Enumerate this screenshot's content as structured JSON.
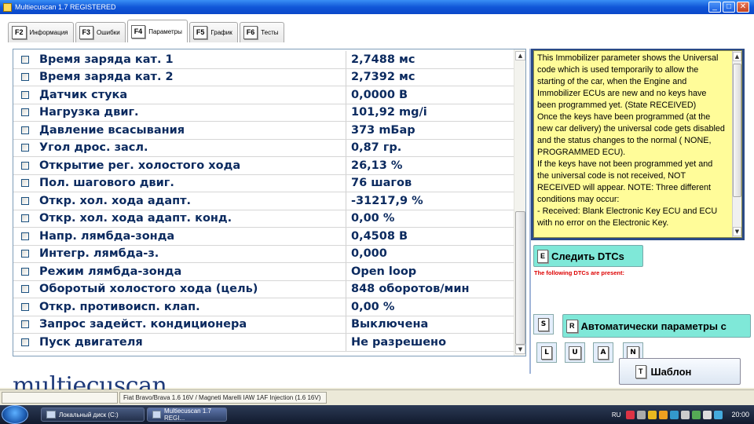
{
  "window": {
    "title": "Multiecuscan 1.7 REGISTERED"
  },
  "tabs": [
    {
      "key": "F2",
      "label": "Информация"
    },
    {
      "key": "F3",
      "label": "Ошибки"
    },
    {
      "key": "F4",
      "label": "Параметры",
      "active": true
    },
    {
      "key": "F5",
      "label": "График"
    },
    {
      "key": "F6",
      "label": "Тесты"
    }
  ],
  "parameters": [
    {
      "name": "Время заряда кат. 1",
      "value": "2,7488 мс"
    },
    {
      "name": "Время заряда кат. 2",
      "value": "2,7392 мс"
    },
    {
      "name": "Датчик стука",
      "value": "0,0000 В"
    },
    {
      "name": "Нагрузка двиг.",
      "value": "101,92 mg/i"
    },
    {
      "name": "Давление всасывания",
      "value": "373 mБар"
    },
    {
      "name": "Угол дрос. засл.",
      "value": "0,87 гр."
    },
    {
      "name": "Открытие рег. холостого хода",
      "value": "26,13 %"
    },
    {
      "name": "Пол. шагового двиг.",
      "value": "76 шагов"
    },
    {
      "name": "Откр. хол. хода адапт.",
      "value": "-31217,9 %"
    },
    {
      "name": "Откр. хол. хода адапт. конд.",
      "value": "0,00 %"
    },
    {
      "name": "Напр. лямбда-зонда",
      "value": "0,4508 В"
    },
    {
      "name": "Интегр. лямбда-з.",
      "value": "0,000"
    },
    {
      "name": "Режим лямбда-зонда",
      "value": "Open loop"
    },
    {
      "name": "Оборотый холостого хода (цель)",
      "value": "848 оборотов/мин"
    },
    {
      "name": "Откр. противоисп. клап.",
      "value": "0,00 %"
    },
    {
      "name": "Запрос задейст. кондиционера",
      "value": "Выключена"
    },
    {
      "name": "Пуск двигателя",
      "value": "Не разрешено"
    }
  ],
  "info_text": "This Immobilizer parameter shows the Universal code which is used temporarily to allow the starting of the car, when the Engine and Immobilizer ECUs are new and no keys have been programmed yet. (State RECEIVED)\nOnce the keys have been programmed (at the new car delivery) the universal code gets disabled and the status changes to the normal ( NONE,  PROGRAMMED ECU).\nIf the keys have not been programmed yet and the universal code is not received, NOT RECEIVED will appear. NOTE: Three different conditions may occur:\n- Received: Blank Electronic Key ECU and ECU with no error on the Electronic Key.",
  "dtc": {
    "key": "E",
    "label": "Следить DTCs",
    "message": "The following DTCs are present:"
  },
  "buttons": {
    "s_key": "S",
    "auto_key": "R",
    "auto_label": "Автоматически параметры с",
    "l_key": "L",
    "u_key": "U",
    "a_key": "A",
    "n_key": "N",
    "template_key": "T",
    "template_label": "Шаблон"
  },
  "logo": "multiecuscan",
  "status": {
    "vehicle": "Fiat Bravo/Brava 1.6 16V / Magneti Marelli IAW 1AF Injection (1.6 16V)"
  },
  "taskbar": {
    "items": [
      "Локальный диск (C:)",
      "Multiecuscan 1.7 REGI..."
    ],
    "lang": "RU",
    "clock": "20:00"
  }
}
